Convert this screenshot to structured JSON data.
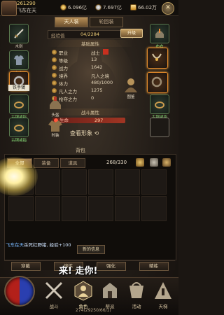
{
  "topbar": {
    "level": "261290",
    "player_name": "飞东在天",
    "currencies": [
      {
        "name": "gold",
        "value": "6.096亿"
      },
      {
        "name": "silver",
        "value": "7.697亿"
      },
      {
        "name": "ingot",
        "value": "66.02万"
      }
    ],
    "close_symbol": "✕"
  },
  "panel_tabs": [
    {
      "label": "天人装",
      "active": true
    },
    {
      "label": "轮回装",
      "active": false
    }
  ],
  "equipment": {
    "left": [
      {
        "label": "木剑",
        "icon": "sword-icon"
      },
      {
        "label": "布衣",
        "icon": "armor-icon"
      },
      {
        "label": "铁手镯",
        "icon": "bracelet-icon"
      },
      {
        "label": "古铜戒指",
        "icon": "ring-icon"
      },
      {
        "label": "古铜戒指",
        "icon": "ring-icon"
      }
    ],
    "right": [
      {
        "label": "布衣",
        "icon": "armor-icon"
      },
      {
        "label": "",
        "icon": "necklace-icon"
      },
      {
        "label": "",
        "icon": "bracelet-icon"
      },
      {
        "label": "古铜戒指",
        "icon": "ring-icon"
      },
      {
        "label": "",
        "icon": "empty-slot"
      }
    ],
    "fashion_label": "时装",
    "figure_label": "图鉴",
    "char_tab_label": "头盔"
  },
  "exp": {
    "label": "经验值",
    "value": "04/2284",
    "upgrade_label": "升级"
  },
  "basic_title": "基础属性",
  "basic_stats": [
    {
      "key": "职业",
      "value": "战士"
    },
    {
      "key": "等级",
      "value": "13"
    },
    {
      "key": "战力",
      "value": "1642"
    },
    {
      "key": "境界",
      "value": "凡人之境"
    },
    {
      "key": "体力",
      "value": "480/1000"
    },
    {
      "key": "凡人之力",
      "value": "1275"
    },
    {
      "key": "抢夺之力",
      "value": "0"
    }
  ],
  "combat_title": "战斗属性",
  "combat_stats": [
    {
      "key": "生命",
      "value": "297"
    }
  ],
  "look_form": "查看形象",
  "bag": {
    "title": "背包",
    "tabs": [
      {
        "label": "全部",
        "active": true
      },
      {
        "label": "装备",
        "active": false
      },
      {
        "label": "道具",
        "active": false
      }
    ],
    "capacity": "268/330"
  },
  "chat": {
    "who": "飞东在天",
    "text": "杀死红野猪, 经验+100"
  },
  "new_info": "新的信息",
  "actions": [
    "穿戴",
    "熔炼",
    "强化",
    "精练"
  ],
  "speech": "来! 走你!",
  "nav": [
    {
      "label": "战斗",
      "icon": "battle-icon"
    },
    {
      "label": "角色",
      "icon": "character-icon",
      "active": true
    },
    {
      "label": "帮派",
      "icon": "guild-icon"
    },
    {
      "label": "活动",
      "icon": "event-icon"
    },
    {
      "label": "天梯",
      "icon": "ladder-icon"
    }
  ],
  "coords": "274(29250/66/1)",
  "colors": {
    "accent": "#f3d27a",
    "equip_border": "#5b7a4f",
    "highlight": "#e38a2a",
    "chat_name": "#79b8ff"
  }
}
